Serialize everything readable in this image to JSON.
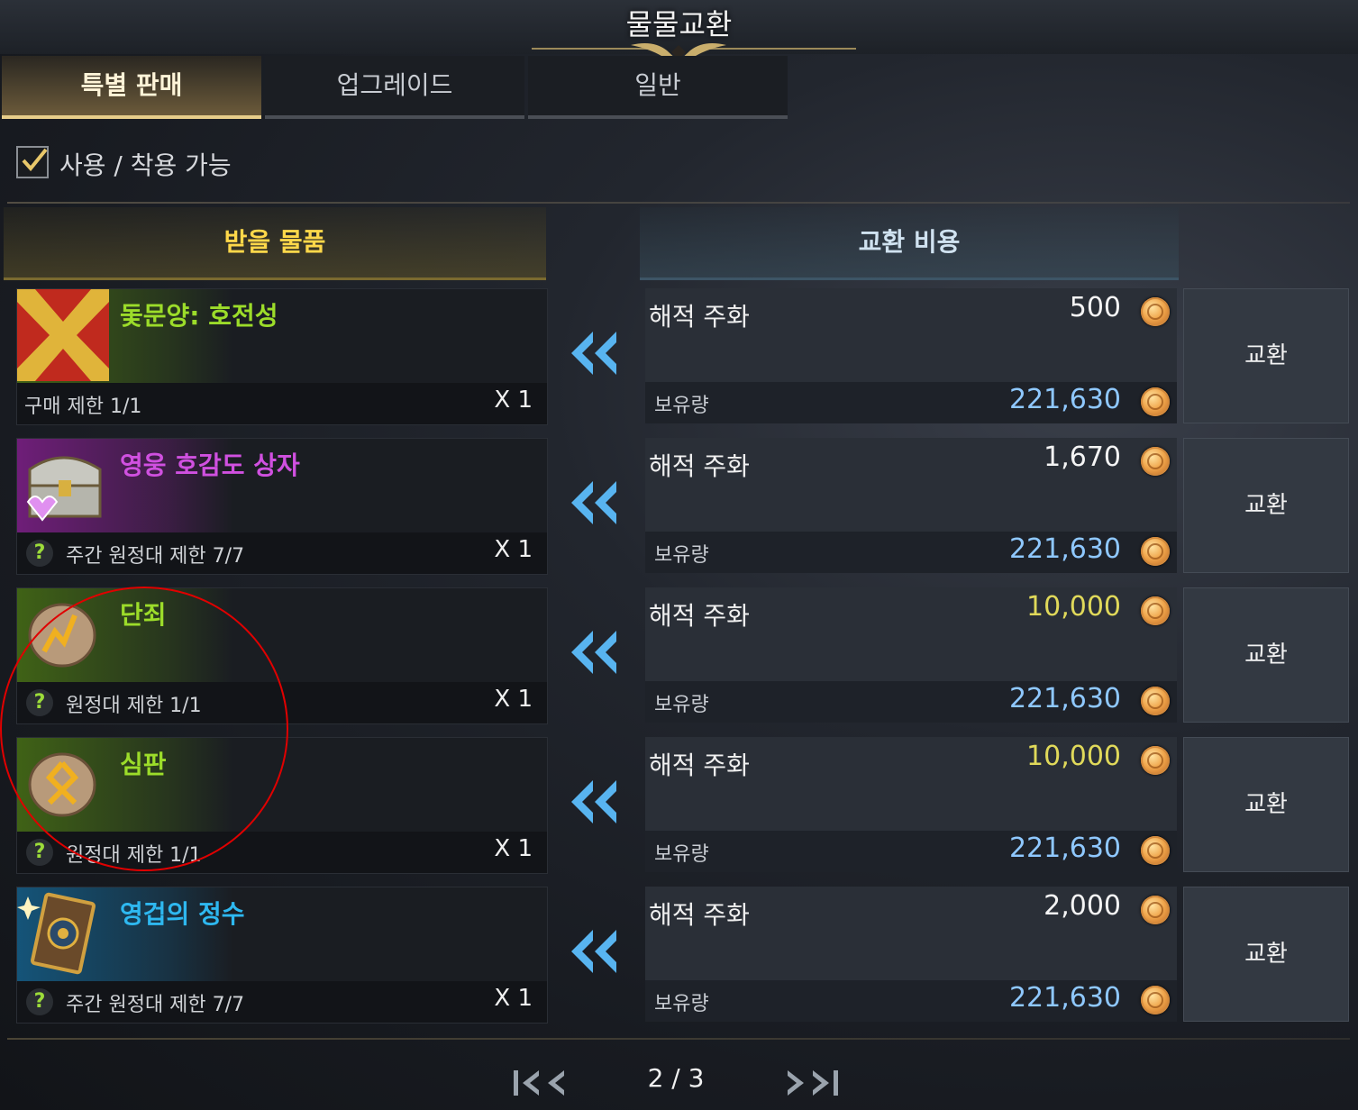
{
  "window": {
    "title": "물물교환"
  },
  "tabs": [
    {
      "label": "특별 판매",
      "active": true
    },
    {
      "label": "업그레이드",
      "active": false
    },
    {
      "label": "일반",
      "active": false
    }
  ],
  "filter": {
    "label": "사용 / 착용 가능",
    "checked": true
  },
  "columns": {
    "receive": "받을 물품",
    "cost": "교환 비용"
  },
  "rows": [
    {
      "item_name": "돛문양: 호전성",
      "item_color": "#9cdc2a",
      "icon": "flag-x-icon",
      "limit": "구매 제한 1/1",
      "has_help": false,
      "qty": "X 1",
      "currency": "해적 주화",
      "price": "500",
      "price_color": "#f4f4f4",
      "held_label": "보유량",
      "held": "221,630",
      "button": "교환"
    },
    {
      "item_name": "영웅 호감도 상자",
      "item_color": "#d050e0",
      "icon": "treasure-chest-icon",
      "limit": "주간 원정대 제한 7/7",
      "has_help": true,
      "qty": "X 1",
      "currency": "해적 주화",
      "price": "1,670",
      "price_color": "#f4f4f4",
      "held_label": "보유량",
      "held": "221,630",
      "button": "교환"
    },
    {
      "item_name": "단죄",
      "item_color": "#9cdc2a",
      "icon": "rune-stone-icon",
      "limit": "원정대 제한 1/1",
      "has_help": true,
      "qty": "X 1",
      "currency": "해적 주화",
      "price": "10,000",
      "price_color": "#e0d95a",
      "held_label": "보유량",
      "held": "221,630",
      "button": "교환"
    },
    {
      "item_name": "심판",
      "item_color": "#9cdc2a",
      "icon": "rune-stone-icon",
      "limit": "원정대 제한 1/1",
      "has_help": true,
      "qty": "X 1",
      "currency": "해적 주화",
      "price": "10,000",
      "price_color": "#e0d95a",
      "held_label": "보유량",
      "held": "221,630",
      "button": "교환"
    },
    {
      "item_name": "영겁의 정수",
      "item_color": "#2eb8f0",
      "icon": "card-icon",
      "limit": "주간 원정대 제한 7/7",
      "has_help": true,
      "qty": "X 1",
      "currency": "해적 주화",
      "price": "2,000",
      "price_color": "#f4f4f4",
      "held_label": "보유량",
      "held": "221,630",
      "button": "교환"
    }
  ],
  "pager": {
    "text": "2 / 3"
  },
  "colors": {
    "accent_gold": "#e7cd8a",
    "held_blue": "#8fc8ff",
    "annotation_red": "#e00000"
  }
}
